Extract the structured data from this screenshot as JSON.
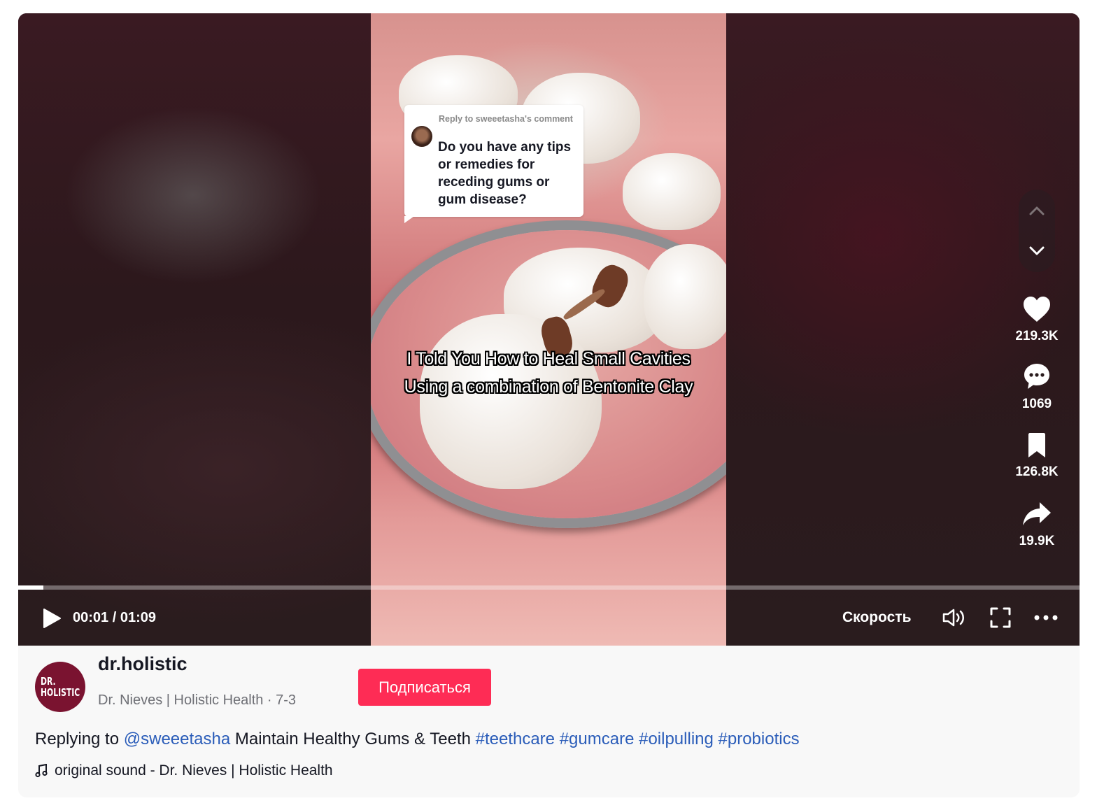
{
  "video": {
    "reply_bubble": {
      "header": "Reply to sweeetasha's comment",
      "question": "Do you have any tips or remedies for receding gums or gum disease?"
    },
    "overlay_caption": "I Told You How to Heal Small Cavities Using a combination of Bentonite Clay",
    "progress": 0.024
  },
  "actions": {
    "likes": "219.3K",
    "comments": "1069",
    "bookmarks": "126.8K",
    "shares": "19.9K"
  },
  "controls": {
    "time": "00:01 / 01:09",
    "speed_label": "Скорость"
  },
  "author": {
    "avatar_text_line1": "DR.",
    "avatar_text_line2": "HOLISTIC",
    "username": "dr.holistic",
    "subline": "Dr. Nieves | Holistic Health · 7-3",
    "follow_label": "Подписаться"
  },
  "description": {
    "prefix": "Replying to ",
    "mention": "@sweeetasha",
    "text": " Maintain Healthy Gums & Teeth ",
    "hashtags": [
      "#teethcare",
      "#gumcare",
      "#oilpulling",
      "#probiotics"
    ]
  },
  "music": {
    "label": "original sound - Dr. Nieves | Holistic Health"
  },
  "colors": {
    "follow_button": "#fe2c55",
    "link": "#2b5db9",
    "avatar_bg": "#7a1330"
  }
}
